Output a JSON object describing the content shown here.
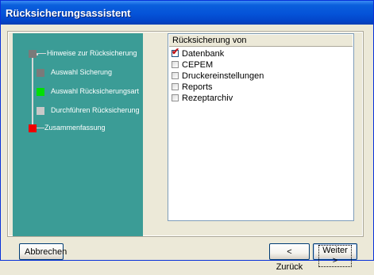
{
  "window": {
    "title": "Rücksicherungsassistent"
  },
  "steps": [
    {
      "label": "Hinweise zur Rücksicherung",
      "state": "done",
      "color": "#7a7a7a"
    },
    {
      "label": "Auswahl Sicherung",
      "state": "done",
      "color": "#7a7a7a"
    },
    {
      "label": "Auswahl Rücksicherungsart",
      "state": "current",
      "color": "#00e000"
    },
    {
      "label": "Durchführen Rücksicherung",
      "state": "pending",
      "color": "#c8c8c8"
    },
    {
      "label": "Zusammenfassung",
      "state": "error",
      "color": "#ee0000"
    }
  ],
  "restore_list": {
    "header": "Rücksicherung von",
    "items": [
      {
        "label": "Datenbank",
        "checked": true
      },
      {
        "label": "CEPEM",
        "checked": false
      },
      {
        "label": "Druckereinstellungen",
        "checked": false
      },
      {
        "label": "Reports",
        "checked": false
      },
      {
        "label": "Rezeptarchiv",
        "checked": false
      }
    ]
  },
  "buttons": {
    "cancel": "Abbrechen",
    "back": "< Zurück",
    "next": "Weiter >"
  }
}
